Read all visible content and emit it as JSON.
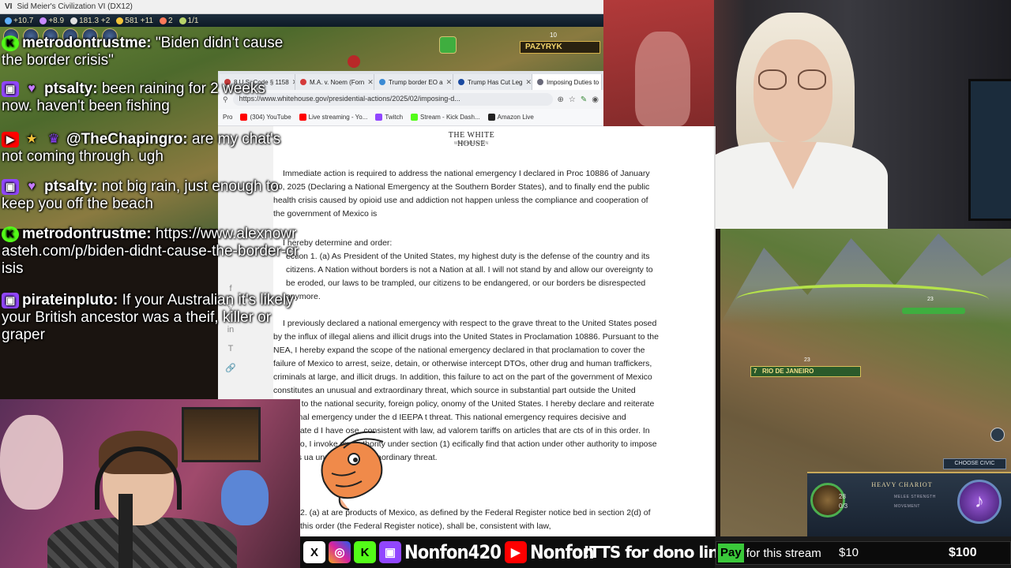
{
  "game": {
    "window_title": "Sid Meier's Civilization VI (DX12)",
    "window_prefix": "VI",
    "resources": [
      {
        "icon": "science-icon",
        "value": "+10.7",
        "color": "#5fb0ff"
      },
      {
        "icon": "culture-icon",
        "value": "+8.9",
        "color": "#c98aff"
      },
      {
        "icon": "faith-icon",
        "value": "181.3 +2",
        "color": "#e0e0e0"
      },
      {
        "icon": "gold-icon",
        "value": "581 +11",
        "color": "#f3c43a"
      },
      {
        "icon": "envoy-icon",
        "value": "2",
        "color": "#ff7a5a"
      },
      {
        "icon": "governor-icon",
        "value": "1/1",
        "color": "#b8d36a"
      }
    ],
    "city_top": "PAZYRYK",
    "city_top_pop": "10",
    "city_bottom": "RIO DE JANEIRO",
    "city_bottom_pop": "7",
    "hill_number": "23",
    "hill_number_2": "23",
    "choose_civic": "CHOOSE CIVIC",
    "unit": {
      "name": "HEAVY CHARIOT",
      "melee_strength": "28",
      "movement": "0/3",
      "melee_label": "MELEE STRENGTH",
      "movement_label": "MOVEMENT"
    }
  },
  "browser": {
    "tabs": [
      {
        "label": "8 U.S. Code § 1158",
        "fav": "#c43a3a"
      },
      {
        "label": "M.A. v. Noem (Forn",
        "fav": "#d43a3a"
      },
      {
        "label": "Trump border EO a",
        "fav": "#3a8ad4"
      },
      {
        "label": "Trump Has Cut Leg",
        "fav": "#1a4aa0"
      },
      {
        "label": "Imposing Duties to",
        "fav": "#6a6a7a"
      }
    ],
    "url": "https://www.whitehouse.gov/presidential-actions/2025/02/imposing-d...",
    "bookmarks": [
      {
        "label": "Pro",
        "fav": "#999999"
      },
      {
        "label": "(304) YouTube",
        "fav": "#ff0000"
      },
      {
        "label": "Live streaming - Yo...",
        "fav": "#ff0000"
      },
      {
        "label": "Twitch",
        "fav": "#9146ff"
      },
      {
        "label": "Stream - Kick Dash...",
        "fav": "#53fc18"
      },
      {
        "label": "Amazon Live",
        "fav": "#222222"
      }
    ]
  },
  "document": {
    "logo": "THE WHITE HOUSE",
    "logo_sub": "WASHINGTON",
    "paragraphs": [
      "Immediate action is required to address the national emergency I declared in Proc 10886 of January 20, 2025 (Declaring a National Emergency at the Southern Border States), and to finally end the public health crisis caused by opioid use and addiction not happen unless the compliance and cooperation of the government of Mexico is",
      "I hereby determine and order:",
      "ection 1. (a) As President of the United States, my highest duty is the defense of the country and its citizens. A Nation without borders is not a Nation at all. I will not stand by and allow our overeignty to be eroded, our laws to be trampled, our citizens to be endangered, or our borders be disrespected anymore.",
      "I previously declared a national emergency with respect to the grave threat to the United States posed by the influx of illegal aliens and illicit drugs into the United States in Proclamation 10886. Pursuant to the NEA, I hereby expand the scope of the national emergency declared in that proclamation to cover the failure of Mexico to arrest, seize, detain, or otherwise intercept DTOs, other drug and human traffickers, criminals at large, and illicit drugs. In addition, this failure to act on the part of the government of Mexico constitutes an unusual and extraordinary threat, which source in substantial part outside the United States, to the national security, foreign policy, onomy of the United States. I hereby declare and reiterate a national emergency under the d IEEPA t threat. This national emergency requires decisive and immediate d I have ose, consistent with law, ad valorem tariffs on articles that are cts of in this order. In doing so, I invoke my authority under section (1) ecifically find that action under other authority to impose tariffs is ua unusual and extraordinary threat.",
      "2. (a) at are products of Mexico, as defined by the Federal Register notice bed in section 2(d) of this order (the Federal Register notice), shall be, consistent with law,"
    ]
  },
  "chat": [
    {
      "platform": "kick",
      "user": "metrodontrustme:",
      "text": " \"Biden didn't cause the border crisis\""
    },
    {
      "platform": "twitch",
      "user": "ptsalty:",
      "text": " been raining for 2 weeks now. haven't been fishing"
    },
    {
      "platform": "youtube",
      "user": "@TheChapingro:",
      "text": " are my chat's not coming through. ugh"
    },
    {
      "platform": "twitch",
      "user": "ptsalty:",
      "text": " not big rain, just enough to keep you off the beach"
    },
    {
      "platform": "kick",
      "user": "metrodontrustme:",
      "text": " https://www.alexnowrasteh.com/p/biden-didnt-cause-the-border-crisis"
    },
    {
      "platform": "twitch",
      "user": "pirateinpluto:",
      "text": " If your Australian it's likely your British ancestor was a theif, killer or graper"
    }
  ],
  "bottom_bar": {
    "handle_twitch_kick": "Nonfon420",
    "handle_youtube": "Nonfon",
    "tts": "!TTS for dono link",
    "pay_label": "Pay",
    "pay_text": "for this stream",
    "goal_current": "$10",
    "goal_target": "$100",
    "goal_progress_fraction": 0.1
  }
}
